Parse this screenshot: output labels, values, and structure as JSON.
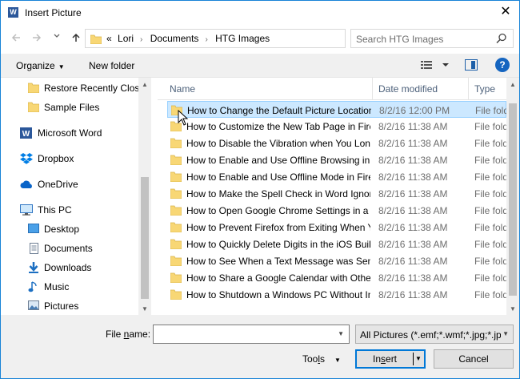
{
  "window": {
    "title": "Insert Picture",
    "close_glyph": "✕",
    "app_icon_letter": "W"
  },
  "address": {
    "overflow": "«",
    "crumbs": [
      "Lori",
      "Documents",
      "HTG Images"
    ],
    "search_placeholder": "Search HTG Images"
  },
  "toolbar": {
    "organize": "Organize",
    "new_folder": "New folder",
    "help": "?"
  },
  "nav": {
    "items": [
      {
        "label": "Restore Recently Closed",
        "icon": "folder-icon"
      },
      {
        "label": "Sample Files",
        "icon": "folder-icon"
      },
      {
        "label": "Microsoft Word",
        "icon": "word-icon"
      },
      {
        "label": "Dropbox",
        "icon": "dropbox-icon"
      },
      {
        "label": "OneDrive",
        "icon": "onedrive-icon"
      },
      {
        "label": "This PC",
        "icon": "pc-icon"
      },
      {
        "label": "Desktop",
        "icon": "desktop-icon"
      },
      {
        "label": "Documents",
        "icon": "documents-icon"
      },
      {
        "label": "Downloads",
        "icon": "downloads-icon"
      },
      {
        "label": "Music",
        "icon": "music-icon"
      },
      {
        "label": "Pictures",
        "icon": "pictures-icon"
      }
    ]
  },
  "list": {
    "columns": {
      "name": "Name",
      "date": "Date modified",
      "type": "Type"
    },
    "rows": [
      {
        "name": "How to Change the Default Picture Location",
        "date": "8/2/16 12:00 PM",
        "type": "File folder"
      },
      {
        "name": "How to Customize the New Tab Page in Firefox",
        "date": "8/2/16 11:38 AM",
        "type": "File folder"
      },
      {
        "name": "How to Disable the Vibration when You Long-Press",
        "date": "8/2/16 11:38 AM",
        "type": "File folder"
      },
      {
        "name": "How to Enable and Use Offline Browsing in Chrome",
        "date": "8/2/16 11:38 AM",
        "type": "File folder"
      },
      {
        "name": "How to Enable and Use Offline Mode in Firefox",
        "date": "8/2/16 11:38 AM",
        "type": "File folder"
      },
      {
        "name": "How to Make the Spell Check in Word Ignore",
        "date": "8/2/16 11:38 AM",
        "type": "File folder"
      },
      {
        "name": "How to Open Google Chrome Settings in a Separate Window",
        "date": "8/2/16 11:38 AM",
        "type": "File folder"
      },
      {
        "name": "How to Prevent Firefox from Exiting When You Close",
        "date": "8/2/16 11:38 AM",
        "type": "File folder"
      },
      {
        "name": "How to Quickly Delete Digits in the iOS Built-in Calculator",
        "date": "8/2/16 11:38 AM",
        "type": "File folder"
      },
      {
        "name": "How to See When a Text Message was Sent",
        "date": "8/2/16 11:38 AM",
        "type": "File folder"
      },
      {
        "name": "How to Share a Google Calendar with Others",
        "date": "8/2/16 11:38 AM",
        "type": "File folder"
      },
      {
        "name": "How to Shutdown a Windows PC Without Installing Updates",
        "date": "8/2/16 11:38 AM",
        "type": "File folder"
      }
    ]
  },
  "bottom": {
    "file_name_label_pre": "File ",
    "file_name_label_u": "n",
    "file_name_label_post": "ame:",
    "file_name_value": "",
    "filter": "All Pictures (*.emf;*.wmf;*.jpg;*.jpeg;*.png)",
    "tools_pre": "Too",
    "tools_u": "l",
    "tools_post": "s",
    "insert_pre": "In",
    "insert_u": "s",
    "insert_post": "ert",
    "cancel": "Cancel"
  },
  "colors": {
    "accent": "#0078d7",
    "selection": "#cce8ff",
    "folder": "#f8d775",
    "toolbar_bg": "#f0f0f0"
  }
}
